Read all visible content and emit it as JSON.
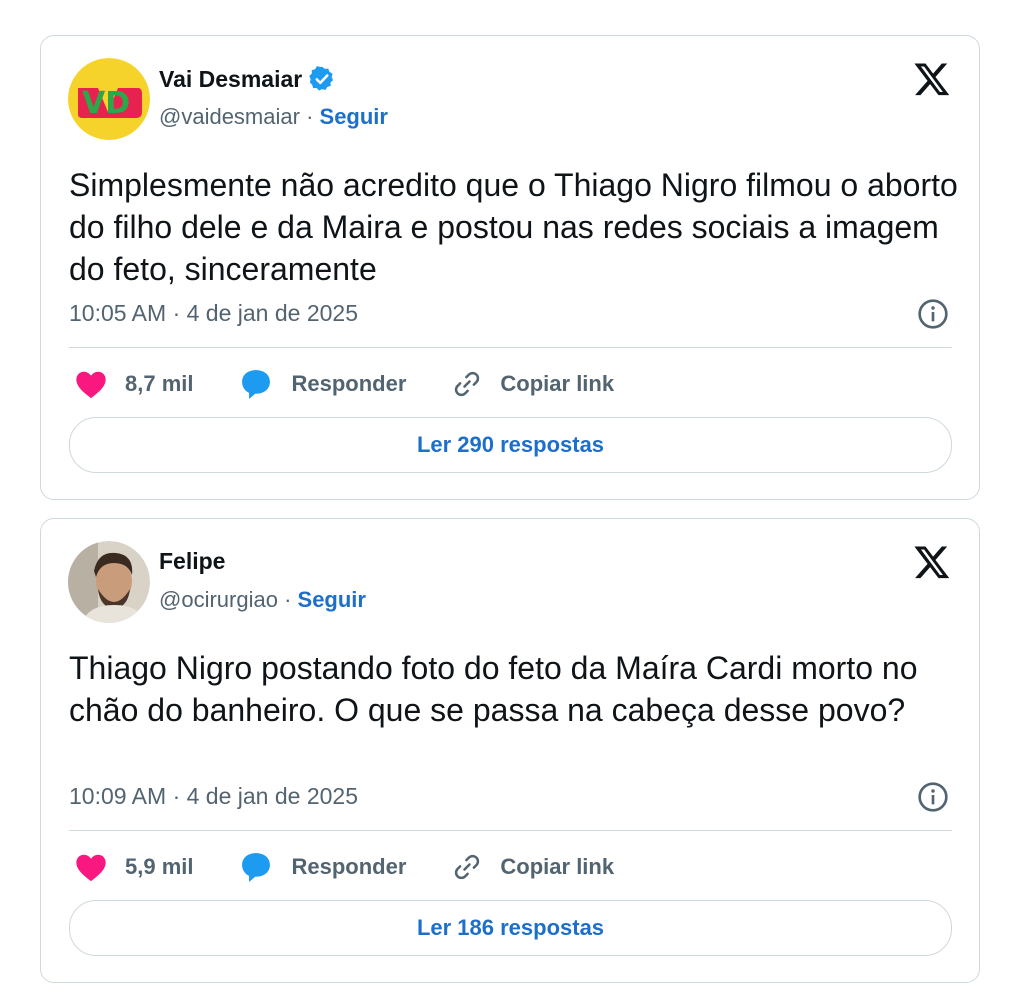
{
  "tweets": [
    {
      "display_name": "Vai Desmaiar",
      "verified": true,
      "handle": "@vaidesmaiar",
      "separator": "·",
      "follow_label": "Seguir",
      "text": "Simplesmente não acredito que o Thiago Nigro filmou o aborto do filho dele e da Maira e postou nas redes sociais a imagem do feto, sinceramente",
      "timestamp": "10:05 AM · 4 de jan de 2025",
      "likes": "8,7 mil",
      "reply_label": "Responder",
      "copy_label": "Copiar link",
      "read_replies": "Ler 290 respostas",
      "avatar_text": "VD"
    },
    {
      "display_name": "Felipe",
      "verified": false,
      "handle": "@ocirurgiao",
      "separator": "·",
      "follow_label": "Seguir",
      "text": "Thiago Nigro postando foto do feto da Maíra Cardi morto no chão do banheiro. O que se passa na cabeça desse povo?",
      "timestamp": "10:09 AM · 4 de jan de 2025",
      "likes": "5,9 mil",
      "reply_label": "Responder",
      "copy_label": "Copiar link",
      "read_replies": "Ler 186 respostas"
    }
  ],
  "colors": {
    "link": "#1d6fc9",
    "heart": "#f91880",
    "bubble": "#1d9bf0",
    "muted": "#536471",
    "border": "#cfd9de"
  }
}
